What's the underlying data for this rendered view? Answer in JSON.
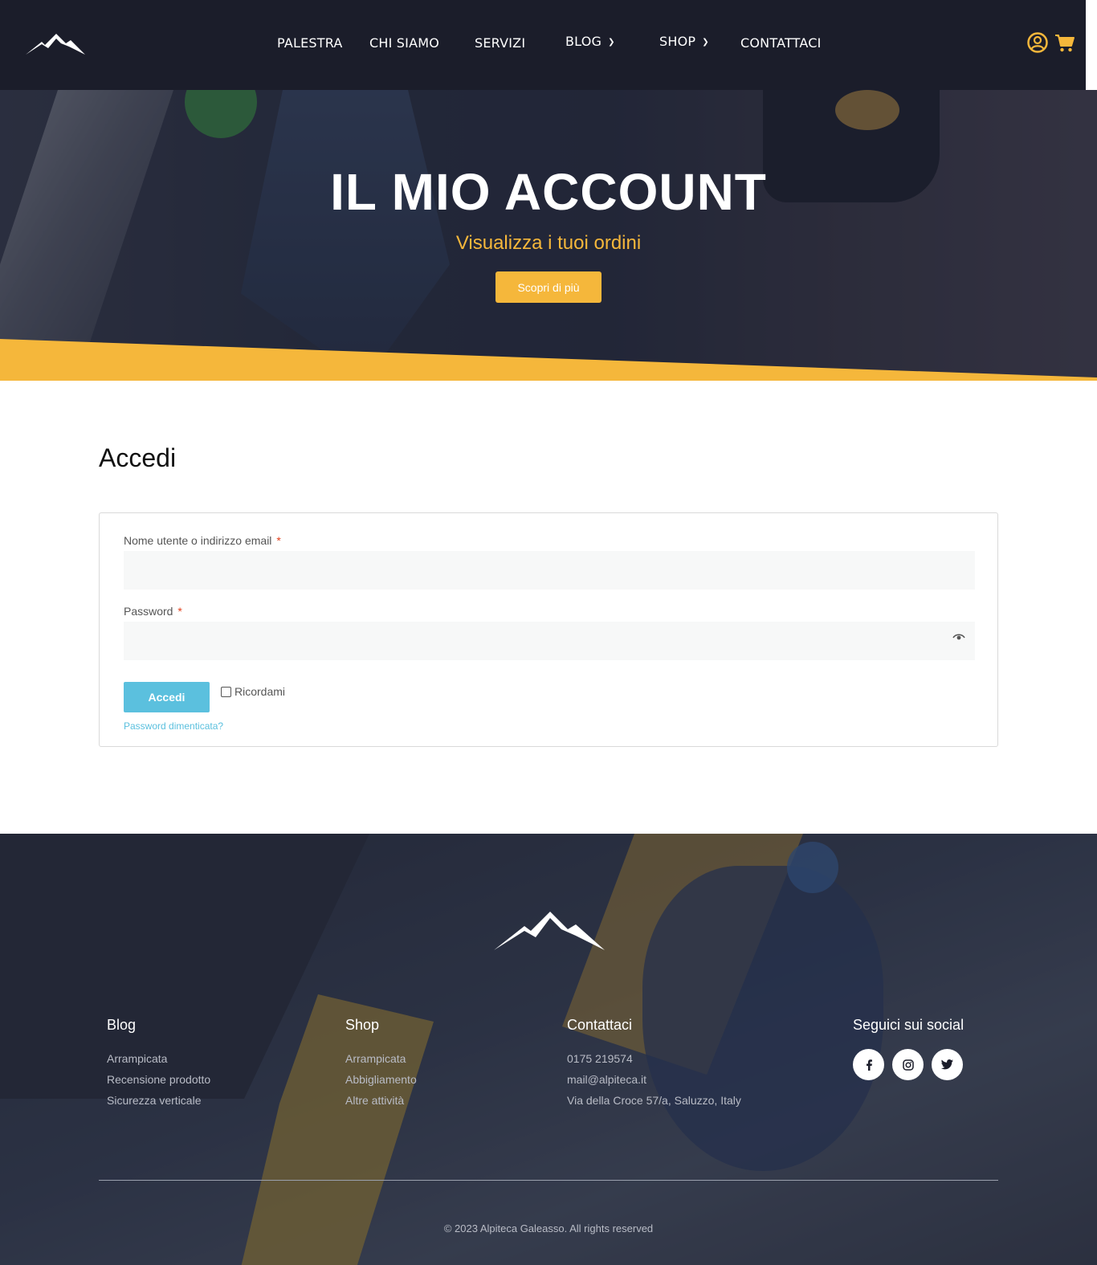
{
  "header": {
    "nav": [
      {
        "label": "PALESTRA"
      },
      {
        "label": "CHI SIAMO"
      },
      {
        "label": "SERVIZI"
      },
      {
        "label": "BLOG",
        "has_dropdown": true
      },
      {
        "label": "SHOP",
        "has_dropdown": true
      },
      {
        "label": "CONTATTACI"
      }
    ],
    "icons": [
      "account-icon",
      "cart-icon"
    ]
  },
  "hero": {
    "title": "IL MIO ACCOUNT",
    "subtitle": "Visualizza i tuoi ordini",
    "button_label": "Scopri di più"
  },
  "login": {
    "title": "Accedi",
    "username_label": "Nome utente o indirizzo email",
    "password_label": "Password",
    "required_mark": "*",
    "username_value": "",
    "password_value": "",
    "submit_label": "Accedi",
    "remember_label": "Ricordami",
    "forgot_label": "Password dimenticata?"
  },
  "footer": {
    "columns": [
      {
        "title": "Blog",
        "links": [
          "Arrampicata",
          "Recensione prodotto",
          "Sicurezza verticale"
        ]
      },
      {
        "title": "Shop",
        "links": [
          "Arrampicata",
          "Abbigliamento",
          "Altre attività"
        ]
      },
      {
        "title": "Contattaci",
        "links": [
          "0175 219574",
          "mail@alpiteca.it",
          "Via della Croce 57/a, Saluzzo, Italy"
        ]
      }
    ],
    "social_title": "Seguici sui social",
    "social": [
      "facebook-icon",
      "instagram-icon",
      "twitter-icon"
    ],
    "copyright": "© 2023 Alpiteca Galeasso. All rights reserved"
  },
  "colors": {
    "header_bg": "#1b1d2a",
    "accent": "#f5b73b",
    "login_button": "#5bc0de",
    "required": "#e2401c"
  }
}
